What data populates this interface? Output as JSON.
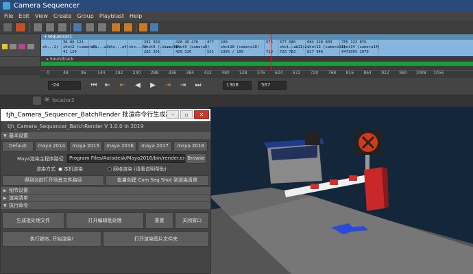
{
  "sequencer": {
    "title": "Camera Sequencer",
    "menu": [
      "File",
      "Edit",
      "View",
      "Create",
      "Group",
      "Playblast",
      "Help"
    ],
    "sequence_name": "sequencer1",
    "sound_label": "Soundtrack",
    "shots": [
      {
        "w": 30,
        "name": "sh...1)",
        "n1": "",
        "n2": ""
      },
      {
        "w": 40,
        "name": "shot2 (camera2)",
        "n1": "36  86  121",
        "n2": "41    126"
      },
      {
        "w": 26,
        "name": "sho...a3)",
        "n1": "",
        "n2": ""
      },
      {
        "w": 30,
        "name": "sho...a4)",
        "n1": "",
        "n2": ""
      },
      {
        "w": 22,
        "name": "sho...5)",
        "n1": "",
        "n2": ""
      },
      {
        "w": 26,
        "name": "shot6 (...mera6)",
        "n1": "281   326",
        "n2": "282   361"
      },
      {
        "w": 20,
        "name": "sh...7)",
        "n1": "",
        "n2": ""
      },
      {
        "w": 46,
        "name": "shot9 (camera9)",
        "n1": "428   49   476",
        "n2": "429   520"
      },
      {
        "w": 20,
        "name": "",
        "n1": "477",
        "n2": "521"
      },
      {
        "w": 66,
        "name": "shot10 (camera10)",
        "n1": "  100",
        "n2": "199%   /   199"
      },
      {
        "w": 20,
        "name": "",
        "n1": "576",
        "n2": "719"
      },
      {
        "w": 20,
        "name": "shot...a11)",
        "n1": "577  640",
        "n2": "720  783"
      },
      {
        "w": 20,
        "name": "sh...2)",
        "n1": "",
        "n2": ""
      },
      {
        "w": 50,
        "name": "shot13 (camera13)",
        "n1": "684   120  803",
        "n2": "827      946"
      },
      {
        "w": 56,
        "name": "shot14 (camera14)",
        "n1": "755  122  876",
        "n2": "947109%   1079"
      }
    ],
    "ruler_ticks": [
      "0",
      "48",
      "96",
      "144",
      "192",
      "240",
      "288",
      "336",
      "384",
      "432",
      "480",
      "528",
      "576",
      "624",
      "672",
      "720",
      "768",
      "816",
      "864",
      "912",
      "960",
      "1008",
      "1056"
    ],
    "start_field": "-24",
    "end_field": "1308",
    "current_field": "567"
  },
  "outliner": {
    "item": "locator2"
  },
  "batch": {
    "title": "tjh_Camera_Sequencer_BatchRender 批渲命令行生成器",
    "heading": "tjh_Camera_Sequencer_BatchRender V 1.0.0    in 2019",
    "sec_basic": "基本设置",
    "versions": [
      "Default",
      "maya 2014",
      "maya 2015",
      "maya 2016",
      "maya 2017",
      "maya 2018"
    ],
    "path_label": "Maya渲染主程序路径",
    "path_value": "Program Files/Autodesk/Maya2016/bin/render.exe",
    "browse": "Browse",
    "mode_label": "渲染方式",
    "mode_local": "本机渲染",
    "mode_net": "网络渲染 (请看说明帮助)",
    "btn_get_path": "得到当前打开场景文件路径",
    "btn_batch_create": "批量创建 Cam Seq Shot 到渲染清单",
    "sec_detail": "细节设置",
    "sec_list": "渲染清单",
    "sec_exec": "执行命令",
    "btn_gen": "生成批处理文件",
    "btn_open_edit": "打开编辑批处理",
    "btn_reset": "重置",
    "btn_close": "关闭窗口",
    "btn_run": "执行脚本, 开始渲染!",
    "btn_open_folder": "打开渲染图片文件夹"
  }
}
